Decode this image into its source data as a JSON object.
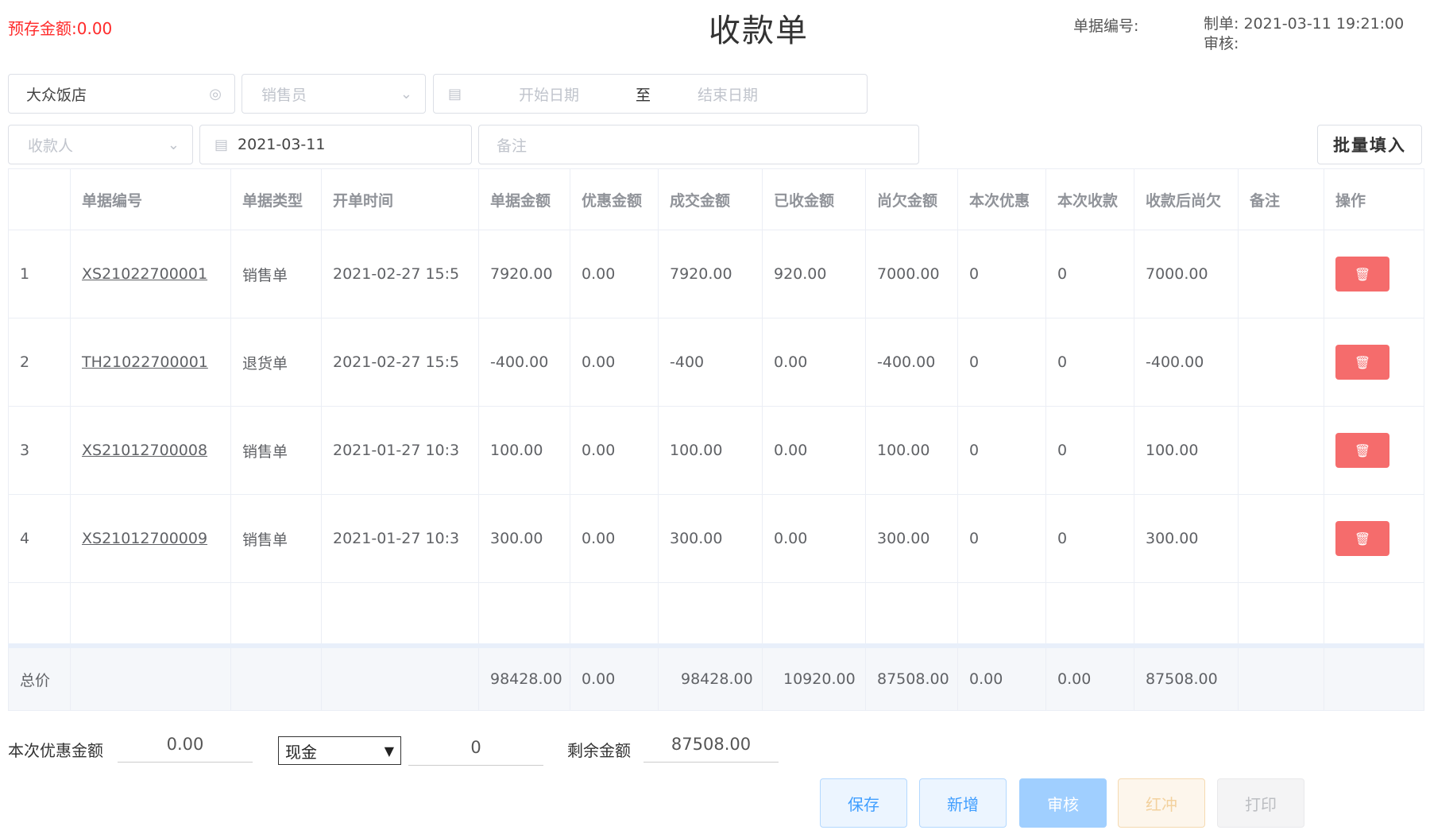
{
  "header": {
    "prepaid": "预存金额:0.00",
    "title": "收款单",
    "bill_no_label": "单据编号:",
    "creator": "制单: 2021-03-11 19:21:00",
    "auditor": "审核:"
  },
  "filters": {
    "customer": "大众饭店",
    "salesman_placeholder": "销售员",
    "start_date_placeholder": "开始日期",
    "date_separator": "至",
    "end_date_placeholder": "结束日期",
    "payee_placeholder": "收款人",
    "pay_date": "2021-03-11",
    "remark_placeholder": "备注",
    "batch_fill": "批量填入"
  },
  "table": {
    "columns": [
      "",
      "单据编号",
      "单据类型",
      "开单时间",
      "单据金额",
      "优惠金额",
      "成交金额",
      "已收金额",
      "尚欠金额",
      "本次优惠",
      "本次收款",
      "收款后尚欠",
      "备注",
      "操作"
    ],
    "rows": [
      {
        "idx": "1",
        "no": "XS21022700001",
        "type": "销售单",
        "time": "2021-02-27 15:5",
        "amount": "7920.00",
        "discount": "0.00",
        "deal": "7920.00",
        "received": "920.00",
        "owed": "7000.00",
        "cur_discount": "0",
        "cur_receive": "0",
        "after_owed": "7000.00",
        "remark": ""
      },
      {
        "idx": "2",
        "no": "TH21022700001",
        "type": "退货单",
        "time": "2021-02-27 15:5",
        "amount": "-400.00",
        "discount": "0.00",
        "deal": "-400",
        "received": "0.00",
        "owed": "-400.00",
        "cur_discount": "0",
        "cur_receive": "0",
        "after_owed": "-400.00",
        "remark": ""
      },
      {
        "idx": "3",
        "no": "XS21012700008",
        "type": "销售单",
        "time": "2021-01-27 10:3",
        "amount": "100.00",
        "discount": "0.00",
        "deal": "100.00",
        "received": "0.00",
        "owed": "100.00",
        "cur_discount": "0",
        "cur_receive": "0",
        "after_owed": "100.00",
        "remark": ""
      },
      {
        "idx": "4",
        "no": "XS21012700009",
        "type": "销售单",
        "time": "2021-01-27 10:3",
        "amount": "300.00",
        "discount": "0.00",
        "deal": "300.00",
        "received": "0.00",
        "owed": "300.00",
        "cur_discount": "0",
        "cur_receive": "0",
        "after_owed": "300.00",
        "remark": ""
      }
    ],
    "totals": {
      "label": "总价",
      "amount": "98428.00",
      "discount": "0.00",
      "deal": "98428.00",
      "received": "10920.00",
      "owed": "87508.00",
      "cur_discount": "0.00",
      "cur_receive": "0.00",
      "after_owed": "87508.00"
    }
  },
  "bottom": {
    "discount_label": "本次优惠金额",
    "discount_value": "0.00",
    "pay_method": "现金",
    "pay_amount": "0",
    "remaining_label": "剩余金额",
    "remaining_value": "87508.00"
  },
  "actions": {
    "save": "保存",
    "new": "新增",
    "audit": "审核",
    "red_flush": "红冲",
    "print": "打印"
  },
  "colors": {
    "prepaid_red": "#ff2a2a",
    "delete_red": "#f56c6c",
    "primary_blue": "#409eff"
  }
}
